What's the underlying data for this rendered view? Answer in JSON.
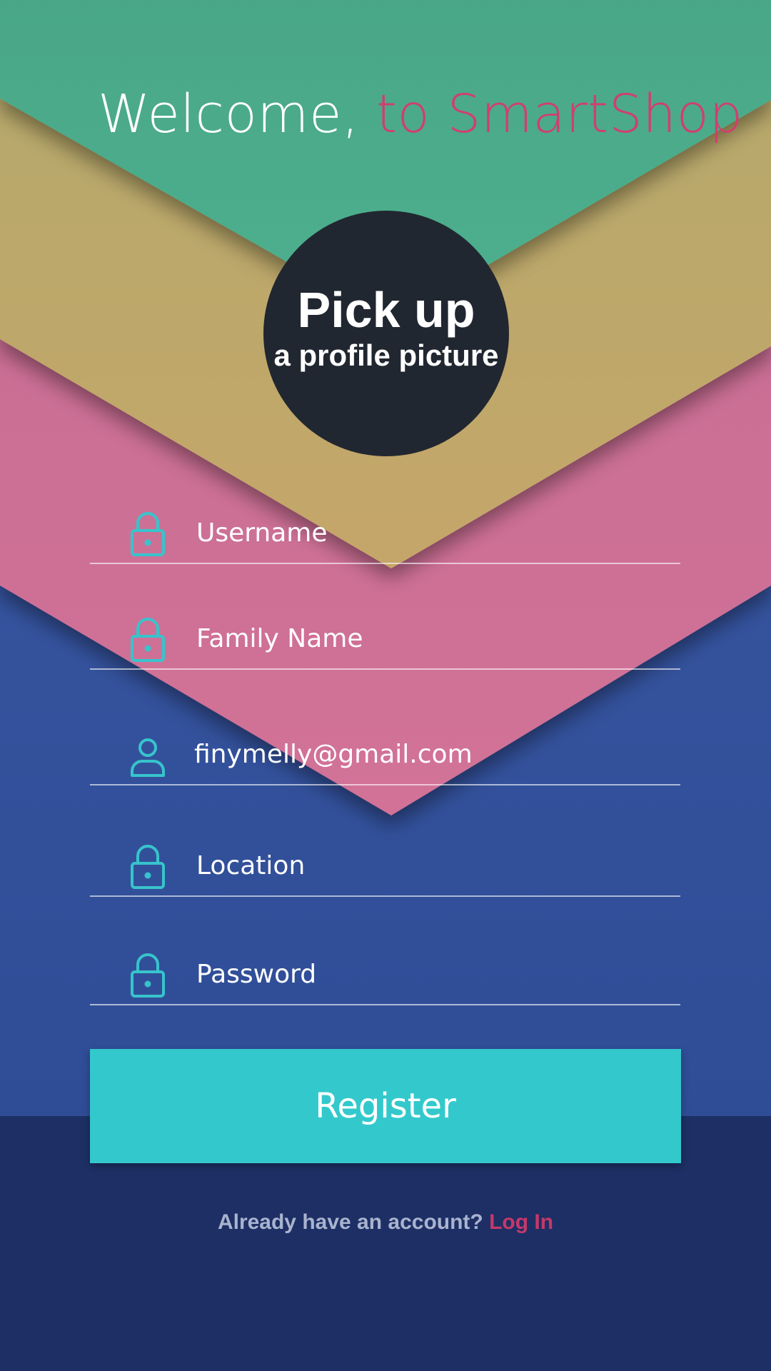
{
  "header": {
    "title_part1": "Welcome,",
    "title_part2": "to SmartShop"
  },
  "avatar": {
    "line1": "Pick up",
    "line2": "a profile picture"
  },
  "form": {
    "username_placeholder": "Username",
    "family_name_placeholder": "Family Name",
    "email_value": "finymelly@gmail.com",
    "location_placeholder": "Location",
    "password_placeholder": "Password",
    "register_label": "Register"
  },
  "footer": {
    "prompt": "Already have an account?",
    "login_link": "Log In"
  },
  "icons": {
    "lock": "lock-icon",
    "user": "user-icon"
  },
  "colors": {
    "green_band": "#4aa888",
    "gold_band": "#bda86a",
    "pink_band": "#cd6e95",
    "blue_background": "#3755a0",
    "navy_bottom": "#1d2f64",
    "accent_teal": "#33c9cc",
    "accent_pink": "#d23e6e",
    "avatar_circle": "#212730"
  }
}
